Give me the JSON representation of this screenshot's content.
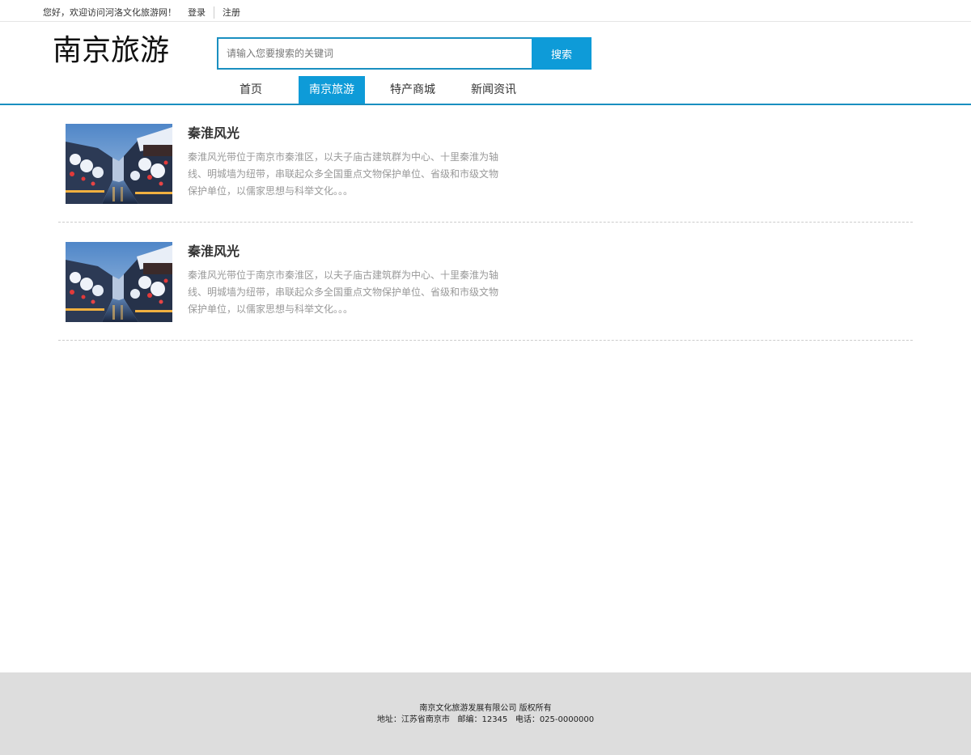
{
  "topbar": {
    "welcome": "您好，欢迎访问河洛文化旅游网！",
    "login": "登录",
    "register": "注册"
  },
  "header": {
    "logo": "南京旅游",
    "search_placeholder": "请输入您要搜索的关键词",
    "search_button": "搜索"
  },
  "nav": {
    "items": [
      {
        "label": "首页"
      },
      {
        "label": "南京旅游"
      },
      {
        "label": "特产商城"
      },
      {
        "label": "新闻资讯"
      }
    ],
    "active": "南京旅游"
  },
  "articles": [
    {
      "title": "秦淮风光",
      "description": "秦淮风光带位于南京市秦淮区，以夫子庙古建筑群为中心、十里秦淮为轴线、明城墙为纽带，串联起众多全国重点文物保护单位、省级和市级文物保护单位，以儒家思想与科举文化。。。"
    },
    {
      "title": "秦淮风光",
      "description": "秦淮风光带位于南京市秦淮区，以夫子庙古建筑群为中心、十里秦淮为轴线、明城墙为纽带，串联起众多全国重点文物保护单位、省级和市级文物保护单位，以儒家思想与科举文化。。。"
    }
  ],
  "footer": {
    "copyright": "南京文化旅游发展有限公司 版权所有",
    "contact": "地址：江苏省南京市   邮编：12345   电话：025-0000000"
  },
  "colors": {
    "accent": "#0e9bd8",
    "border_accent": "#1a8fc0",
    "footer_bg": "#dddddd"
  }
}
